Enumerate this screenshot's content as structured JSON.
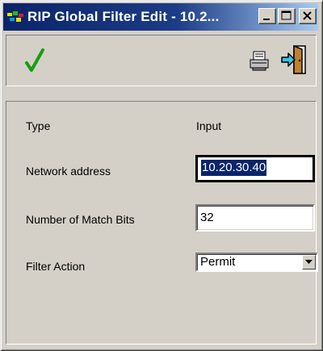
{
  "window": {
    "title": "RIP Global Filter Edit - 10.2..."
  },
  "toolbar": {
    "ok_icon": "checkmark-icon",
    "print_icon": "printer-icon",
    "exit_icon": "exit-door-icon"
  },
  "form": {
    "type_label": "Type",
    "type_value": "Input",
    "network_label": "Network address",
    "network_value": "10.20.30.40",
    "match_bits_label": "Number of Match Bits",
    "match_bits_value": "32",
    "filter_action_label": "Filter Action",
    "filter_action_value": "Permit"
  },
  "colors": {
    "titlebar_start": "#0a246a",
    "titlebar_end": "#a6caf0",
    "face": "#d4d0c8",
    "check_green": "#14a010"
  }
}
